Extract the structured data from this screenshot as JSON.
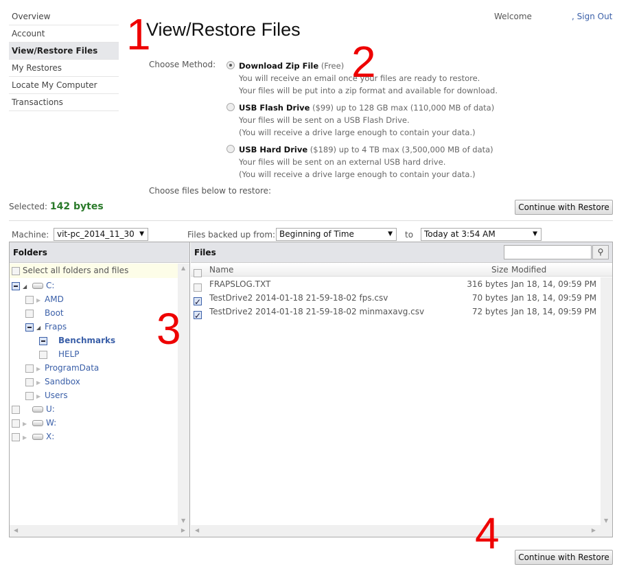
{
  "sidebar": {
    "items": [
      {
        "label": "Overview"
      },
      {
        "label": "Account"
      },
      {
        "label": "View/Restore Files",
        "active": true
      },
      {
        "label": "My Restores"
      },
      {
        "label": "Locate My Computer"
      },
      {
        "label": "Transactions"
      }
    ]
  },
  "header": {
    "welcome": "Welcome",
    "signout": ", Sign Out"
  },
  "title": "View/Restore Files",
  "annotations": [
    "1",
    "2",
    "3",
    "4"
  ],
  "method": {
    "label": "Choose Method:",
    "options": [
      {
        "name": "Download Zip File",
        "price": "(Free)",
        "rest": "",
        "lines": [
          "You will receive an email once your files are ready to restore.",
          "Your files will be put into a zip format and available for download."
        ],
        "selected": true
      },
      {
        "name": "USB Flash Drive",
        "price": "($99)",
        "rest": " up to 128 GB max (110,000 MB of data)",
        "lines": [
          "Your files will be sent on a USB Flash Drive.",
          "(You will receive a drive large enough to contain your data.)"
        ],
        "selected": false
      },
      {
        "name": "USB Hard Drive",
        "price": "($189)",
        "rest": " up to 4 TB max (3,500,000 MB of data)",
        "lines": [
          "Your files will be sent on an external USB hard drive.",
          "(You will receive a drive large enough to contain your data.)"
        ],
        "selected": false
      }
    ]
  },
  "choose_files": "Choose files below to restore:",
  "selected": {
    "label": "Selected:",
    "value": "142 bytes"
  },
  "continue_label": "Continue with Restore",
  "filters": {
    "machine_label": "Machine:",
    "machine": "vit-pc_2014_11_30",
    "from_label": "Files backed up from:",
    "from": "Beginning of Time",
    "to_label": "to",
    "to": "Today at 3:54 AM"
  },
  "folders": {
    "header": "Folders",
    "select_all": "Select all folders and files",
    "tree": [
      {
        "label": "C:",
        "level": 0,
        "drive": true,
        "state": "partial",
        "expander": "open"
      },
      {
        "label": "AMD",
        "level": 1,
        "state": "none",
        "expander": "closed"
      },
      {
        "label": "Boot",
        "level": 1,
        "state": "none",
        "expander": ""
      },
      {
        "label": "Fraps",
        "level": 1,
        "state": "partial",
        "expander": "open"
      },
      {
        "label": "Benchmarks",
        "level": 2,
        "state": "partial",
        "expander": "",
        "bold": true
      },
      {
        "label": "HELP",
        "level": 2,
        "state": "none",
        "expander": ""
      },
      {
        "label": "ProgramData",
        "level": 1,
        "state": "none",
        "expander": "closed"
      },
      {
        "label": "Sandbox",
        "level": 1,
        "state": "none",
        "expander": "closed"
      },
      {
        "label": "Users",
        "level": 1,
        "state": "none",
        "expander": "closed"
      },
      {
        "label": "U:",
        "level": 0,
        "drive": true,
        "state": "none",
        "expander": ""
      },
      {
        "label": "W:",
        "level": 0,
        "drive": true,
        "state": "none",
        "expander": "closed"
      },
      {
        "label": "X:",
        "level": 0,
        "drive": true,
        "state": "none",
        "expander": "closed"
      }
    ]
  },
  "files": {
    "header": "Files",
    "columns": {
      "name": "Name",
      "size": "Size",
      "modified": "Modified"
    },
    "search_placeholder": "",
    "rows": [
      {
        "name": "FRAPSLOG.TXT",
        "size": "316 bytes",
        "modified": "Jan 18, 14, 09:59 PM",
        "checked": false
      },
      {
        "name": "TestDrive2 2014-01-18 21-59-18-02 fps.csv",
        "size": "70 bytes",
        "modified": "Jan 18, 14, 09:59 PM",
        "checked": true
      },
      {
        "name": "TestDrive2 2014-01-18 21-59-18-02 minmaxavg.csv",
        "size": "72 bytes",
        "modified": "Jan 18, 14, 09:59 PM",
        "checked": true
      }
    ]
  }
}
